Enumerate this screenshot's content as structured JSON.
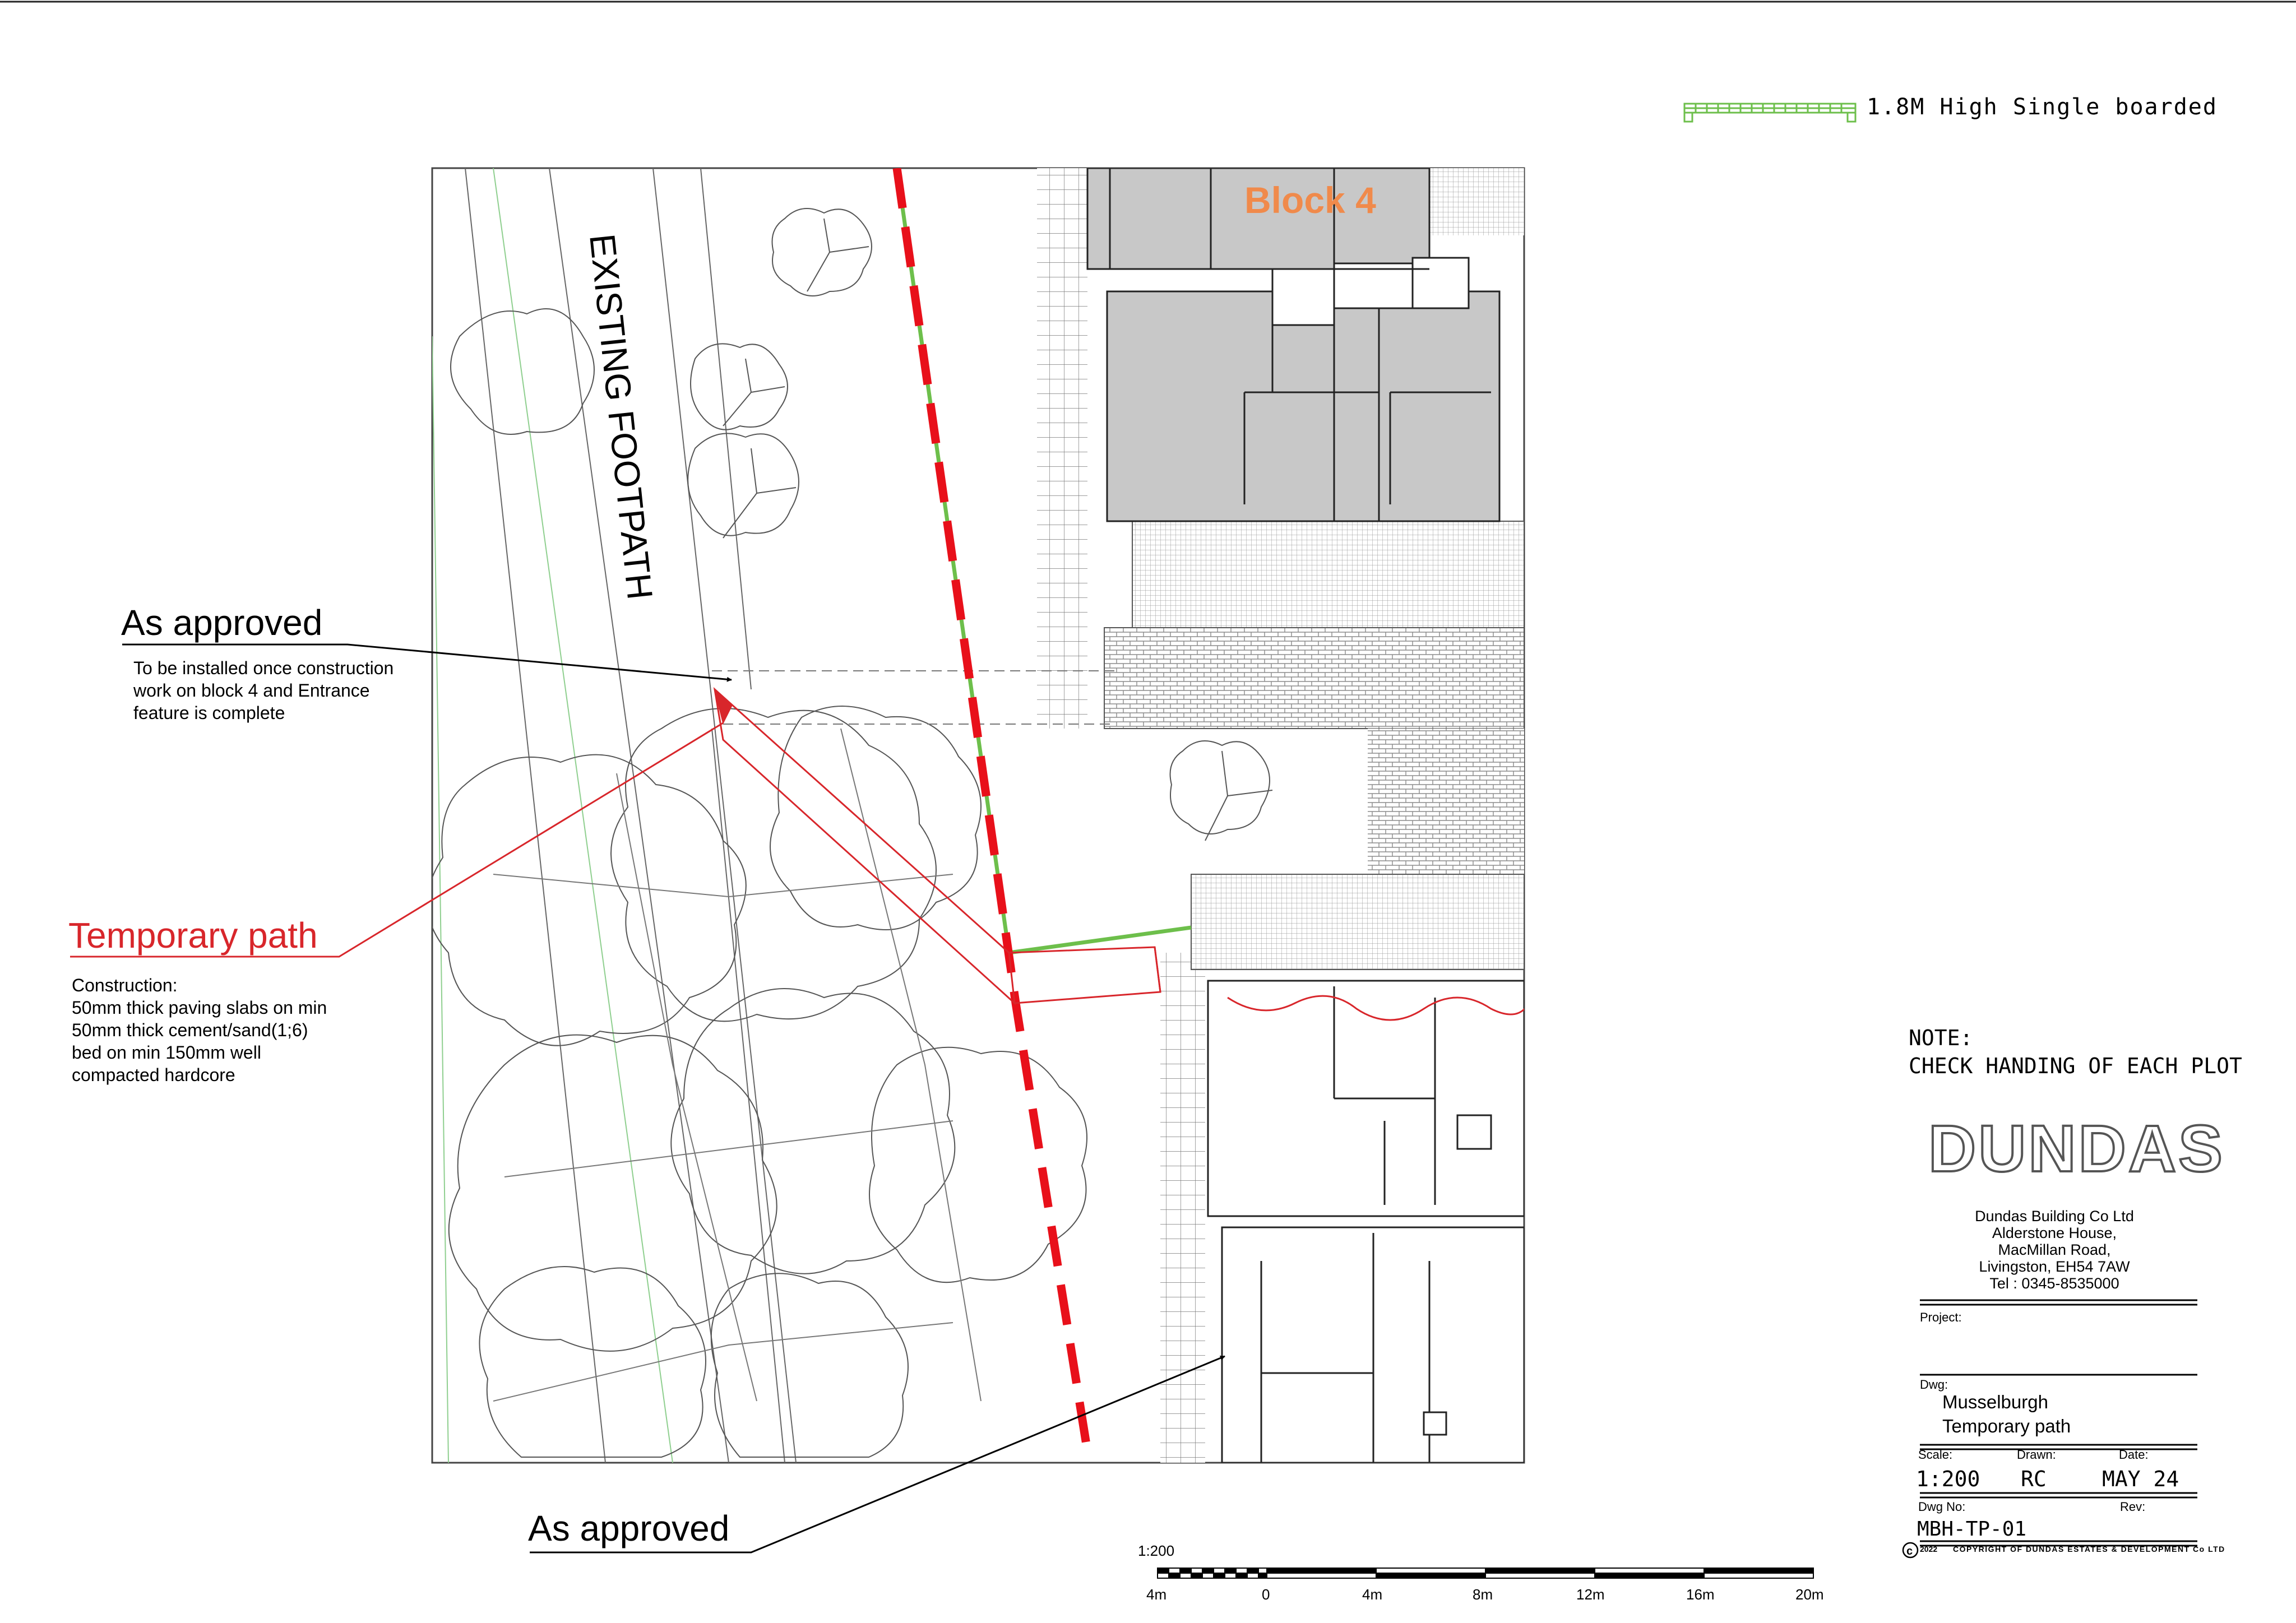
{
  "legend": {
    "fence_label": "1.8M High Single boarded",
    "fence_color": "#6dbf4b"
  },
  "plan": {
    "block_label": "Block 4",
    "block_label_color": "#f08a4b",
    "footpath_label": "EXISTING FOOTPATH",
    "boundary_color": "#e8101a",
    "path_color": "#d8262b"
  },
  "callouts": {
    "as_approved_top": {
      "title": "As approved",
      "note": "To be  installed once construction\nwork on block 4 and Entrance\nfeature is complete"
    },
    "temporary_path": {
      "title": "Temporary path",
      "title_color": "#d8262b",
      "note": "Construction:\n50mm thick paving slabs on min\n50mm thick cement/sand(1;6)\nbed on min 150mm well\ncompacted hardcore"
    },
    "as_approved_bottom": {
      "title": "As approved"
    }
  },
  "scale_bar": {
    "ratio": "1:200",
    "ticks": [
      "4m",
      "0",
      "4m",
      "8m",
      "12m",
      "16m",
      "20m"
    ]
  },
  "title_block": {
    "note_title": "NOTE:",
    "note_text": "CHECK HANDING OF EACH PLOT",
    "logo": "DUNDAS",
    "address": "Dundas Building Co Ltd\nAlderstone House,\nMacMillan Road,\nLivingston, EH54 7AW\nTel : 0345-8535000",
    "project_label": "Project:",
    "dwg_label": "Dwg:",
    "dwg_title_1": "Musselburgh",
    "dwg_title_2": "Temporary path",
    "scale_label": "Scale:",
    "scale_value": "1:200",
    "drawn_label": "Drawn:",
    "drawn_value": "RC",
    "date_label": "Date:",
    "date_value": "MAY 24",
    "dwgno_label": "Dwg No:",
    "dwgno_value": "MBH-TP-01",
    "rev_label": "Rev:",
    "copyright_year": "2022",
    "copyright_text": "COPYRIGHT OF DUNDAS ESTATES & DEVELOPMENT Co LTD"
  }
}
